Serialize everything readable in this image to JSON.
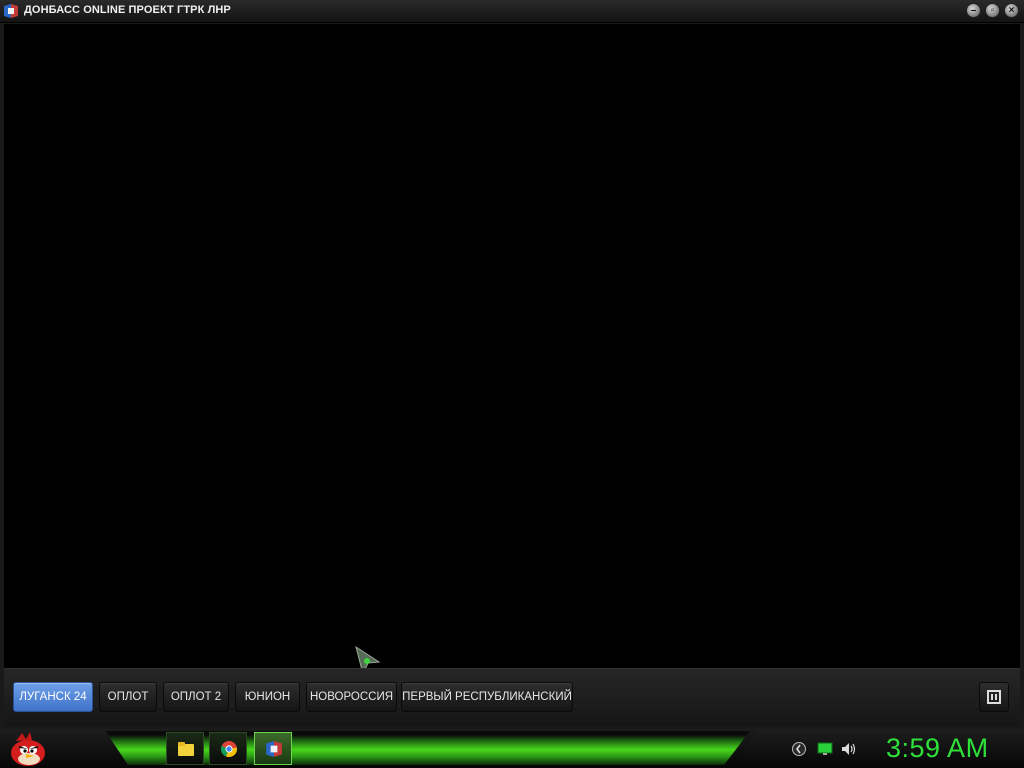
{
  "window": {
    "title": "ДОНБАСС ONLINE ПРОЕКТ ГТРК ЛНР",
    "controls": {
      "minimize_icon": "minimize-icon",
      "restore_icon": "restore-icon",
      "close_icon": "close-icon"
    }
  },
  "channels": [
    {
      "label": "ЛУГАНСК 24",
      "active": true
    },
    {
      "label": "ОПЛОТ",
      "active": false
    },
    {
      "label": "ОПЛОТ 2",
      "active": false
    },
    {
      "label": "ЮНИОН",
      "active": false
    },
    {
      "label": "НОВОРОССИЯ",
      "active": false
    },
    {
      "label": "ПЕРВЫЙ РЕСПУБЛИКАНСКИЙ",
      "active": false
    }
  ],
  "player": {
    "pause_icon": "pause-icon"
  },
  "taskbar": {
    "start_icon": "angry-bird-start-icon",
    "pinned": [
      {
        "icon": "folder-icon",
        "active": false
      },
      {
        "icon": "chrome-icon",
        "active": false
      },
      {
        "icon": "donbass-app-icon",
        "active": true
      }
    ],
    "tray": [
      "network-icon",
      "display-icon",
      "volume-icon"
    ],
    "clock": "3:59 AM"
  },
  "colors": {
    "active_channel": "#4f82d8",
    "taskbar_glow": "#48d61c",
    "clock": "#2fe03a"
  }
}
